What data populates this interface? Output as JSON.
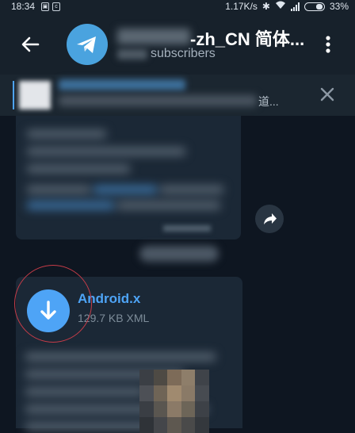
{
  "status_bar": {
    "time": "18:34",
    "network_speed": "1.17K/s",
    "battery": "33%"
  },
  "header": {
    "title_suffix": "-zh_CN 简体...",
    "subscribers": "subscribers"
  },
  "pinned": {
    "text_suffix": "道..."
  },
  "file_message": {
    "file_name": "Android.x",
    "file_info": "129.7 KB XML"
  },
  "colors": {
    "header_bg": "#17212b",
    "chat_bg": "#0e1621",
    "bubble_bg": "#1b2836",
    "accent": "#4ea4f6",
    "highlight_circle": "#c63c48"
  },
  "icons": {
    "back": "arrow-left-icon",
    "avatar": "telegram-logo-icon",
    "menu": "more-vertical-icon",
    "pin_close": "close-icon",
    "share": "share-forward-icon",
    "download": "download-arrow-icon"
  }
}
